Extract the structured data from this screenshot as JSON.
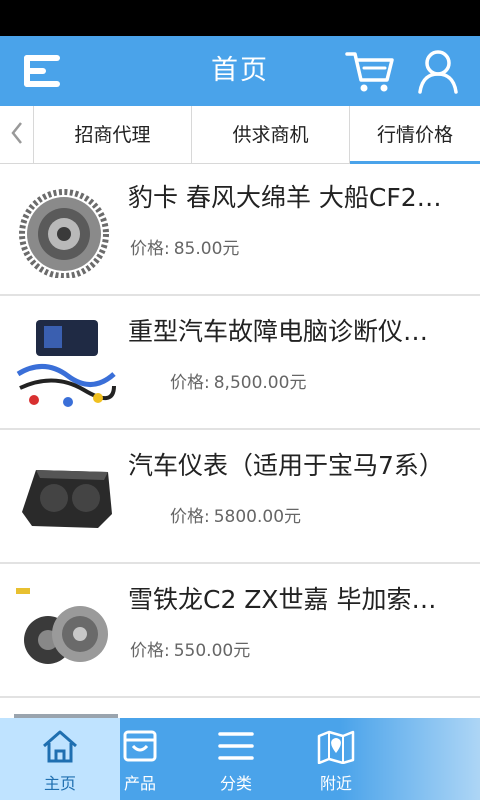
{
  "header": {
    "title": "首页",
    "menu_icon": "menu-icon",
    "cart_icon": "shopping-cart-icon",
    "user_icon": "user-icon",
    "bg_color": "#4aa3ea"
  },
  "tabs": [
    {
      "label": "招商代理",
      "active": false
    },
    {
      "label": "供求商机",
      "active": false
    },
    {
      "label": "行情价格",
      "active": true
    }
  ],
  "products": [
    {
      "title": "豹卡 春风大绵羊 大船CF2…",
      "price_label": "价格:",
      "price": "85.00元",
      "image": "gear-flywheel"
    },
    {
      "title": "重型汽车故障电脑诊断仪…",
      "price_label": "价格:",
      "price": "8,500.00元",
      "image": "diagnostic-kit"
    },
    {
      "title": "汽车仪表（适用于宝马7系）",
      "price_label": "价格:",
      "price": "5800.00元",
      "image": "dashboard-cluster"
    },
    {
      "title": "雪铁龙C2 ZX世嘉 毕加索…",
      "price_label": "价格:",
      "price": "550.00元",
      "image": "clutch-kit"
    }
  ],
  "bottom_nav": [
    {
      "label": "主页",
      "icon": "home-icon",
      "active": true
    },
    {
      "label": "产品",
      "icon": "product-box-icon",
      "active": false
    },
    {
      "label": "分类",
      "icon": "category-list-icon",
      "active": false
    },
    {
      "label": "附近",
      "icon": "map-location-icon",
      "active": false
    }
  ]
}
